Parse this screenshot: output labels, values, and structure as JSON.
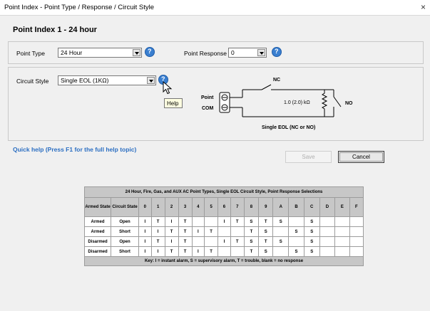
{
  "window": {
    "title": "Point Index - Point Type / Response / Circuit Style",
    "close_glyph": "×"
  },
  "heading": "Point Index 1 - 24 hour",
  "point_type": {
    "label": "Point Type",
    "value": "24 Hour"
  },
  "point_response": {
    "label": "Point Response",
    "value": "0"
  },
  "circuit_style": {
    "label": "Circuit Style",
    "value": "Single EOL (1KΩ)"
  },
  "tooltip": "Help",
  "diagram": {
    "label_nc": "NC",
    "label_no": "NO",
    "label_point": "Point",
    "label_com": "COM",
    "resistor": "1.0 (2.0) kΩ",
    "caption": "Single EOL (NC or NO)"
  },
  "quick_help": "Quick help (Press F1 for the full help topic)",
  "buttons": {
    "save": "Save",
    "cancel": "Cancel"
  },
  "table": {
    "caption": "24 Hour, Fire, Gas, and AUX AC Point Types, Single EOL Circuit Style, Point Response Selections",
    "col_armed": "Armed State",
    "col_circuit": "Circuit State",
    "responses": [
      "0",
      "1",
      "2",
      "3",
      "4",
      "5",
      "6",
      "7",
      "8",
      "9",
      "A",
      "B",
      "C",
      "D",
      "E",
      "F"
    ],
    "rows": [
      {
        "armed": "Armed",
        "circuit": "Open",
        "cells": [
          "I",
          "T",
          "I",
          "T",
          "",
          "",
          "I",
          "T",
          "S",
          "T",
          "S",
          "",
          "S",
          "",
          "",
          ""
        ]
      },
      {
        "armed": "Armed",
        "circuit": "Short",
        "cells": [
          "I",
          "I",
          "T",
          "T",
          "I",
          "T",
          "",
          "",
          "T",
          "S",
          "",
          "S",
          "S",
          "",
          "",
          ""
        ]
      },
      {
        "armed": "Disarmed",
        "circuit": "Open",
        "cells": [
          "I",
          "T",
          "I",
          "T",
          "",
          "",
          "I",
          "T",
          "S",
          "T",
          "S",
          "",
          "S",
          "",
          "",
          ""
        ]
      },
      {
        "armed": "Disarmed",
        "circuit": "Short",
        "cells": [
          "I",
          "I",
          "T",
          "T",
          "I",
          "T",
          "",
          "",
          "T",
          "S",
          "",
          "S",
          "S",
          "",
          "",
          ""
        ]
      }
    ],
    "key": "Key: I = instant alarm, S = supervisory alarm, T = trouble, blank = no response"
  },
  "colors": {
    "accent": "#2c6fc2",
    "help_icon": "#3a7fd0",
    "table_header": "#c7c7c7"
  }
}
